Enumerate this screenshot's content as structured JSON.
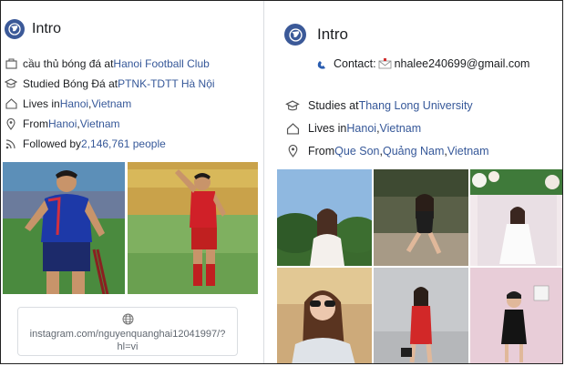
{
  "left": {
    "title": "Intro",
    "rows": [
      {
        "icon": "briefcase-icon",
        "prefix": "cầu thủ bóng đá at ",
        "link": "Hanoi Football Club",
        "suffix": ""
      },
      {
        "icon": "graduation-cap-icon",
        "prefix": "Studied Bóng Đá at ",
        "link": "PTNK-TDTT Hà Nội",
        "suffix": ""
      },
      {
        "icon": "home-icon",
        "prefix": "Lives in ",
        "link": "Hanoi",
        "sep": ", ",
        "link2": "Vietnam"
      },
      {
        "icon": "location-pin-icon",
        "prefix": "From ",
        "link": "Hanoi",
        "sep": ", ",
        "link2": "Vietnam"
      },
      {
        "icon": "rss-icon",
        "prefix": "Followed by ",
        "link": "2,146,761 people",
        "suffix": ""
      }
    ],
    "website": "instagram.com/nguyenquanghai12041997/?hl=vi",
    "colors": {
      "link": "#365899",
      "globe": "#3b5998"
    }
  },
  "right": {
    "title": "Intro",
    "contact_label": "Contact:",
    "contact_email": "nhalee240699@gmail.com",
    "rows": [
      {
        "icon": "graduation-cap-icon",
        "prefix": "Studies at ",
        "link": "Thang Long University"
      },
      {
        "icon": "home-icon",
        "prefix": "Lives in ",
        "link": "Hanoi",
        "sep": ", ",
        "link2": "Vietnam"
      },
      {
        "icon": "location-pin-icon",
        "prefix": "From ",
        "link": "Que Son",
        "sep": ", ",
        "link2": "Quảng Nam",
        "sep2": ", ",
        "link3": "Vietnam"
      }
    ]
  }
}
